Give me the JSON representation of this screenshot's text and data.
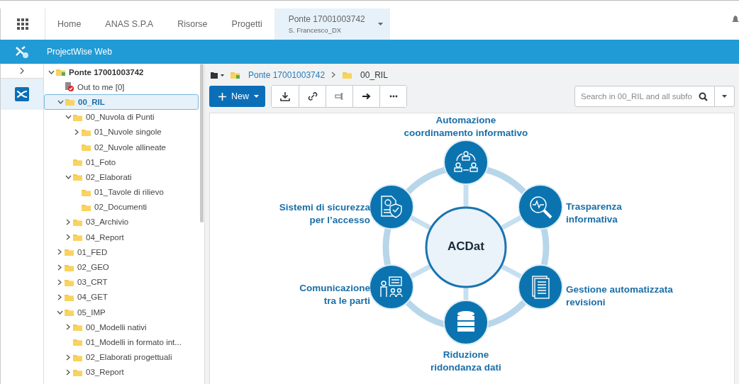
{
  "top_nav": {
    "tabs": [
      {
        "label": "Home",
        "selected": false
      },
      {
        "label": "ANAS S.P.A",
        "selected": false
      },
      {
        "label": "Risorse",
        "selected": false
      },
      {
        "label": "Progetti",
        "selected": false
      },
      {
        "label": "Ponte 17001003742",
        "sublabel": "S. Francesco_DX",
        "selected": true
      }
    ]
  },
  "app_bar": {
    "title": "ProjectWise Web"
  },
  "tree": [
    {
      "label": "Ponte 17001003742",
      "kind": "project",
      "expanded": true,
      "selected": false,
      "children": [
        {
          "label": "Out to me [0]",
          "kind": "out",
          "selected": false
        },
        {
          "label": "00_RIL",
          "kind": "folder",
          "expanded": true,
          "selected": true,
          "children": [
            {
              "label": "00_Nuvola di Punti",
              "kind": "folder",
              "expanded": true,
              "selected": false,
              "children": [
                {
                  "label": "01_Nuvole singole",
                  "kind": "folder",
                  "expanded": false,
                  "selected": false
                },
                {
                  "label": "02_Nuvole allineate",
                  "kind": "folder",
                  "selected": false
                }
              ]
            },
            {
              "label": "01_Foto",
              "kind": "folder",
              "selected": false
            },
            {
              "label": "02_Elaborati",
              "kind": "folder",
              "expanded": true,
              "selected": false,
              "children": [
                {
                  "label": "01_Tavole di rilievo",
                  "kind": "folder",
                  "selected": false
                },
                {
                  "label": "02_Documenti",
                  "kind": "folder",
                  "selected": false
                }
              ]
            },
            {
              "label": "03_Archivio",
              "kind": "folder",
              "expanded": false,
              "selected": false
            },
            {
              "label": "04_Report",
              "kind": "folder",
              "expanded": false,
              "selected": false
            }
          ]
        },
        {
          "label": "01_FED",
          "kind": "folder",
          "expanded": false,
          "selected": false
        },
        {
          "label": "02_GEO",
          "kind": "folder",
          "expanded": false,
          "selected": false
        },
        {
          "label": "03_CRT",
          "kind": "folder",
          "expanded": false,
          "selected": false
        },
        {
          "label": "04_GET",
          "kind": "folder",
          "expanded": false,
          "selected": false
        },
        {
          "label": "05_IMP",
          "kind": "folder",
          "expanded": true,
          "selected": false,
          "children": [
            {
              "label": "00_Modelli nativi",
              "kind": "folder",
              "expanded": false,
              "selected": false
            },
            {
              "label": "01_Modelli in formato int...",
              "kind": "folder",
              "selected": false
            },
            {
              "label": "02_Elaborati progettuali",
              "kind": "folder",
              "expanded": false,
              "selected": false
            },
            {
              "label": "03_Report",
              "kind": "folder",
              "expanded": false,
              "selected": false
            }
          ]
        }
      ]
    }
  ],
  "breadcrumb": [
    {
      "label": "Ponte 17001003742",
      "kind": "project"
    },
    {
      "label": "00_RIL",
      "kind": "folder"
    }
  ],
  "toolbar": {
    "new_button": "New"
  },
  "search": {
    "placeholder": "Search in 00_RIL and all subfo"
  },
  "diagram": {
    "center": "ACDat",
    "nodes": [
      {
        "label": "Automazione\ncoordinamento informativo"
      },
      {
        "label": "Sistemi di sicurezza\nper l’accesso"
      },
      {
        "label": "Trasparenza\ninformativa"
      },
      {
        "label": "Comunicazione\ntra le parti"
      },
      {
        "label": "Gestione automatizzata\nrevisioni"
      },
      {
        "label": "Riduzione\nridondanza dati"
      }
    ]
  }
}
